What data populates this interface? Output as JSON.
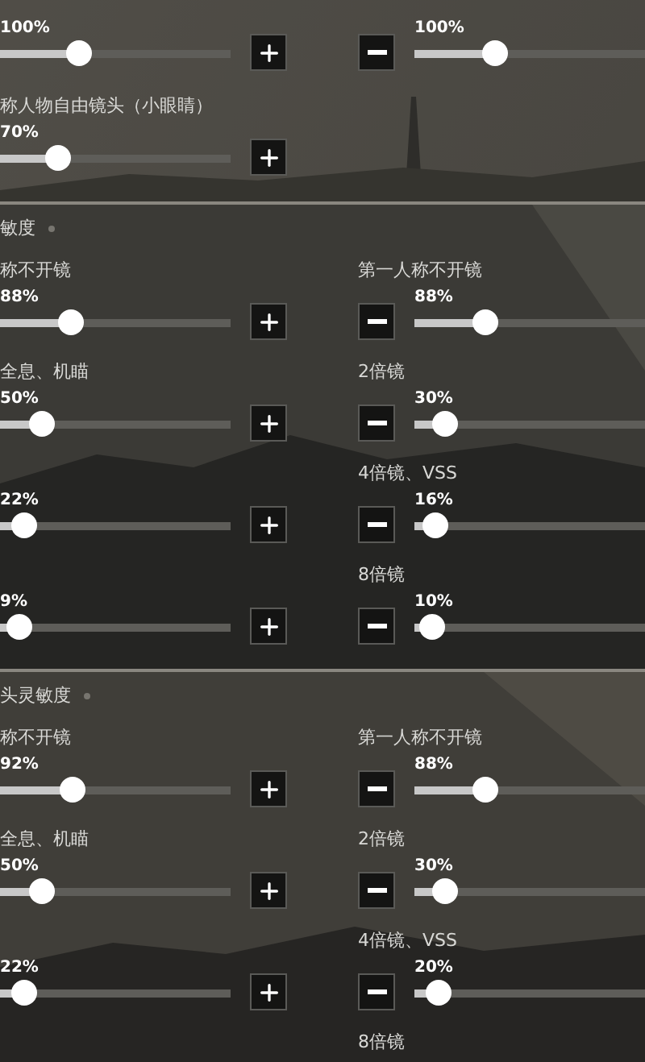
{
  "sections": [
    {
      "rows": [
        {
          "left": {
            "reading": "100%",
            "level": 0.32
          },
          "right": {
            "reading": "100%",
            "level": 0.33
          }
        },
        {
          "left": {
            "label": "称人物自由镜头（小眼睛）",
            "reading": "70%",
            "level": 0.22
          }
        }
      ]
    },
    {
      "header": "敏度",
      "rows": [
        {
          "left": {
            "label": "称不开镜",
            "reading": "88%",
            "level": 0.28
          },
          "right": {
            "label": "第一人称不开镜",
            "reading": "88%",
            "level": 0.28
          }
        },
        {
          "left": {
            "label": "全息、机瞄",
            "reading": "50%",
            "level": 0.145
          },
          "right": {
            "label": "2倍镜",
            "reading": "30%",
            "level": 0.09
          }
        },
        {
          "left": {
            "reading": "22%",
            "level": 0.055
          },
          "right": {
            "label": "4倍镜、VSS",
            "reading": "16%",
            "level": 0.04
          }
        },
        {
          "left": {
            "reading": "9%",
            "level": 0.035
          },
          "right": {
            "label": "8倍镜",
            "reading": "10%",
            "level": 0.02
          }
        }
      ]
    },
    {
      "header": "头灵敏度",
      "rows": [
        {
          "left": {
            "label": "称不开镜",
            "reading": "92%",
            "level": 0.29
          },
          "right": {
            "label": "第一人称不开镜",
            "reading": "88%",
            "level": 0.28
          }
        },
        {
          "left": {
            "label": "全息、机瞄",
            "reading": "50%",
            "level": 0.145
          },
          "right": {
            "label": "2倍镜",
            "reading": "30%",
            "level": 0.09
          }
        },
        {
          "left": {
            "reading": "22%",
            "level": 0.055
          },
          "right": {
            "label": "4倍镜、VSS",
            "reading": "20%",
            "level": 0.055
          }
        },
        {
          "right": {
            "label": "8倍镜"
          }
        }
      ]
    }
  ]
}
